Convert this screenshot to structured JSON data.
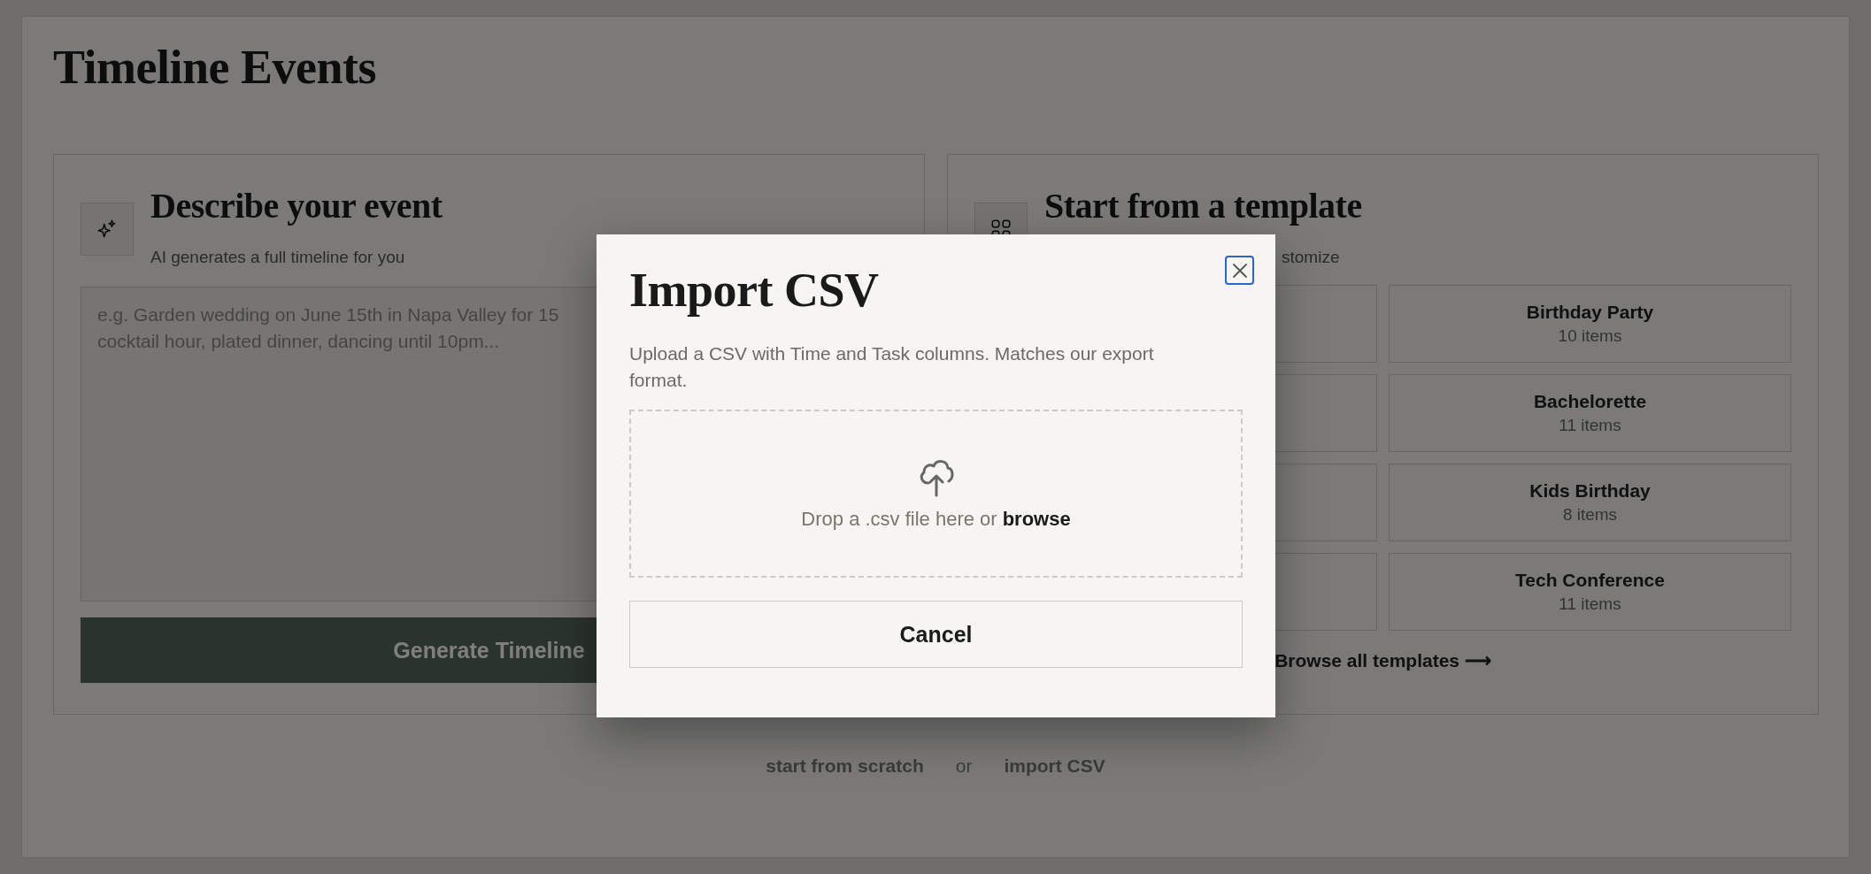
{
  "page": {
    "title": "Timeline Events"
  },
  "describe_card": {
    "title": "Describe your event",
    "subtitle": "AI generates a full timeline for you",
    "prompt": {
      "placeholder": "e.g. Garden wedding on June 15th in Napa Valley for 15\ncocktail hour, plated dinner, dancing until 10pm..."
    },
    "generate_button": "Generate Timeline"
  },
  "template_card": {
    "title": "Start from a template",
    "subtitle": "stomize",
    "templates": [
      {
        "name": "Birthday Party",
        "count": "10 items"
      },
      {
        "name": "Bachelorette",
        "count": "11 items"
      },
      {
        "name": "Kids Birthday",
        "count": "8 items"
      },
      {
        "name": "Tech Conference",
        "count": "11 items"
      }
    ],
    "browse_link": "Browse all templates ⟶"
  },
  "footer": {
    "scratch_link": "start from scratch",
    "separator": "or",
    "import_link": "import CSV"
  },
  "dialog": {
    "title": "Import CSV",
    "close_button": {
      "focused": true
    },
    "description": "Upload a CSV with Time and Task columns. Matches our export format.",
    "dropzone": {
      "text": "Drop a .csv file here or",
      "browse_link": "browse"
    },
    "cancel_button": "Cancel"
  }
}
